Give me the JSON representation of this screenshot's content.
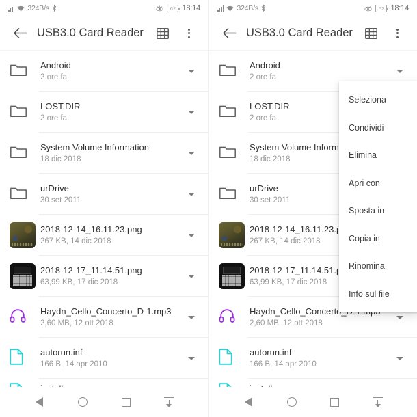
{
  "colors": {
    "accent_audio": "#9b2fd6",
    "accent_doc": "#2ad2d2",
    "text_primary": "#333333",
    "text_secondary": "#9a9a9a",
    "toolbar_title": "#3c3c3c",
    "divider": "#eeeeee"
  },
  "status_bar": {
    "signal_icon": "signal-bars-icon",
    "wifi_icon": "wifi-icon",
    "network_speed": "324B/s",
    "bluetooth_icon": "bluetooth-icon",
    "eye_icon": "eye-care-icon",
    "battery_level": "62",
    "clock": "18:14"
  },
  "toolbar": {
    "back_icon": "arrow-back-icon",
    "title": "USB3.0 Card Reader",
    "grid_icon": "grid-view-icon",
    "overflow_icon": "more-vertical-icon"
  },
  "files": [
    {
      "icon": "folder-icon",
      "type": "folder",
      "name": "Android",
      "meta": "2 ore fa"
    },
    {
      "icon": "folder-icon",
      "type": "folder",
      "name": "LOST.DIR",
      "meta": "2 ore fa"
    },
    {
      "icon": "folder-icon",
      "type": "folder",
      "name": "System Volume Information",
      "meta": "18 dic 2018"
    },
    {
      "icon": "folder-icon",
      "type": "folder",
      "name": "urDrive",
      "meta": "30 set 2011"
    },
    {
      "icon": "image-thumbnail",
      "type": "photo",
      "name": "2018-12-14_16.11.23.png",
      "meta": "267 KB, 14 dic 2018"
    },
    {
      "icon": "image-thumbnail",
      "type": "shot",
      "name": "2018-12-17_11.14.51.png",
      "meta": "63,99 KB, 17 dic 2018"
    },
    {
      "icon": "headphones-icon",
      "type": "audio",
      "name": "Haydn_Cello_Concerto_D-1.mp3",
      "meta": "2,60 MB, 12 ott 2018"
    },
    {
      "icon": "document-icon",
      "type": "doc",
      "name": "autorun.inf",
      "meta": "166 B, 14 apr 2010"
    },
    {
      "icon": "document-icon",
      "type": "doc",
      "name": "install",
      "meta": ""
    }
  ],
  "row_menu_icon": "chevron-down-icon",
  "context_menu": {
    "items": [
      {
        "label": "Seleziona"
      },
      {
        "label": "Condividi"
      },
      {
        "label": "Elimina"
      },
      {
        "label": "Apri con"
      },
      {
        "label": "Sposta in"
      },
      {
        "label": "Copia in"
      },
      {
        "label": "Rinomina"
      },
      {
        "label": "Info sul file"
      }
    ]
  },
  "nav_bar": {
    "back_icon": "nav-back-icon",
    "home_icon": "nav-home-icon",
    "recents_icon": "nav-recents-icon",
    "hide_icon": "nav-hide-keyboard-icon"
  }
}
